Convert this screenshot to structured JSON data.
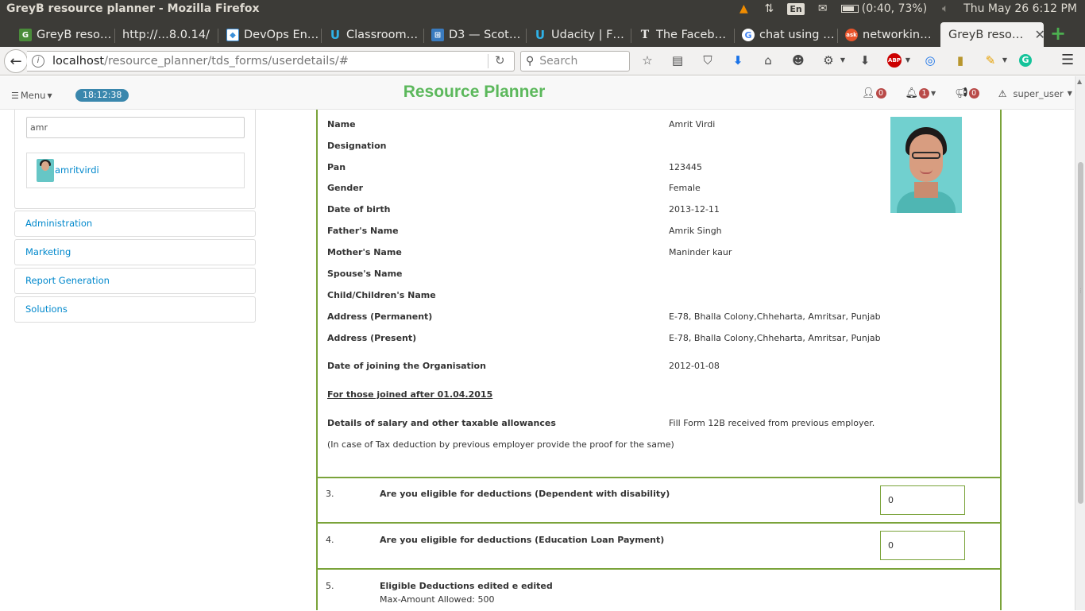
{
  "os": {
    "window_title": "GreyB resource planner - Mozilla Firefox",
    "keyboard_layout": "En",
    "battery": "(0:40, 73%)",
    "datetime": "Thu May 26  6:12 PM"
  },
  "tabs": [
    {
      "label": "GreyB reso…",
      "favicon_color": "#4a8c3a"
    },
    {
      "label": "http://…8.0.14/",
      "favicon_color": ""
    },
    {
      "label": "DevOps En…",
      "favicon_color": "#3b8fd8"
    },
    {
      "label": "Classroom…",
      "favicon_color": "#2fb2e8"
    },
    {
      "label": "D3 — Scot…",
      "favicon_color": "#3a7bbf"
    },
    {
      "label": "Udacity | F…",
      "favicon_color": "#2fb2e8"
    },
    {
      "label": "The Faceb…",
      "favicon_color": "#111111"
    },
    {
      "label": "chat using …",
      "favicon_color": "#4285f4"
    },
    {
      "label": "networkin…",
      "favicon_color": "#e8542b"
    },
    {
      "label": "GreyB reso…",
      "favicon_color": "",
      "active": true
    }
  ],
  "nav": {
    "url_host": "localhost",
    "url_path": "/resource_planner/tds_forms/userdetails/#",
    "search_placeholder": "Search"
  },
  "app": {
    "menu_label": "Menu",
    "clock": "18:12:38",
    "brand": "Resource Planner",
    "user_count": "0",
    "notif_count": "1",
    "announce_count": "0",
    "username": "super_user",
    "brand_color": "#5cb85c"
  },
  "sidebar": {
    "search_value": "amr",
    "user_result": "amritvirdi",
    "items": [
      "Administration",
      "Marketing",
      "Report Generation",
      "Solutions"
    ]
  },
  "form": {
    "fields": [
      {
        "label": "Name",
        "value": "Amrit Virdi"
      },
      {
        "label": "Designation",
        "value": ""
      },
      {
        "label": "Pan",
        "value": "123445"
      },
      {
        "label": "Gender",
        "value": "Female"
      },
      {
        "label": "Date of birth",
        "value": "2013-12-11"
      },
      {
        "label": "Father's Name",
        "value": "Amrik Singh"
      },
      {
        "label": "Mother's Name",
        "value": "Maninder kaur"
      },
      {
        "label": "Spouse's Name",
        "value": ""
      },
      {
        "label": "Child/Children's Name",
        "value": ""
      },
      {
        "label": "Address (Permanent)",
        "value": "E-78, Bhalla Colony,Chheharta, Amritsar, Punjab"
      },
      {
        "label": "Address (Present)",
        "value": "E-78, Bhalla Colony,Chheharta, Amritsar, Punjab"
      },
      {
        "label": "Date of joining the Organisation",
        "value": "2012-01-08"
      }
    ],
    "joined_note": "For those joined after 01.04.2015",
    "salary_label": "Details of salary and other taxable allowances",
    "salary_value": "Fill Form 12B received from previous employer.",
    "tax_note": "(In case of Tax deduction by previous employer provide the proof for the same)",
    "questions": [
      {
        "num": "3.",
        "text": "Are you eligible for deductions (Dependent with disability)",
        "value": "0"
      },
      {
        "num": "4.",
        "text": "Are you eligible for deductions (Education Loan Payment)",
        "value": "0"
      },
      {
        "num": "5.",
        "text": "Eligible Deductions edited e edited",
        "sub": "Max-Amount Allowed: 500"
      }
    ]
  }
}
